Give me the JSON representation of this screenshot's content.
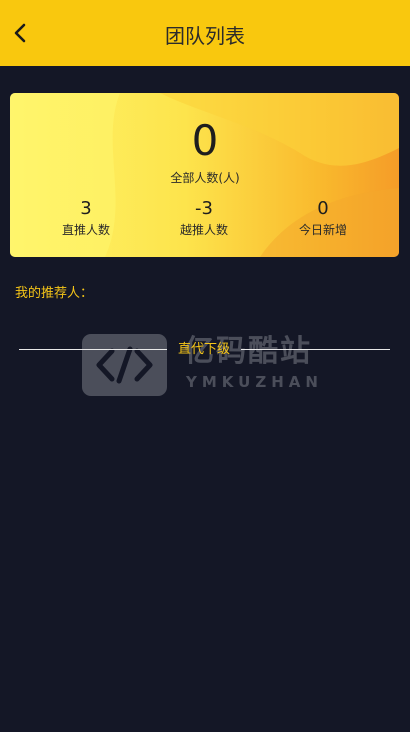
{
  "header": {
    "title": "团队列表",
    "back_icon": "chevron-left-icon",
    "background": "#f9c80e"
  },
  "stats": {
    "total_count": "0",
    "total_label": "全部人数(人)",
    "direct_count": "3",
    "direct_label": "直推人数",
    "indirect_count": "-3",
    "indirect_label": "越推人数",
    "today_count": "0",
    "today_label": "今日新增"
  },
  "referrer": {
    "label": "我的推荐人："
  },
  "section": {
    "title": "直代下级"
  },
  "watermark": {
    "text": "亿码酷站",
    "subtext": "YMKUZHAN",
    "icon": "code-brackets-icon"
  },
  "colors": {
    "accent": "#f5c518",
    "page_background": "#141726"
  }
}
